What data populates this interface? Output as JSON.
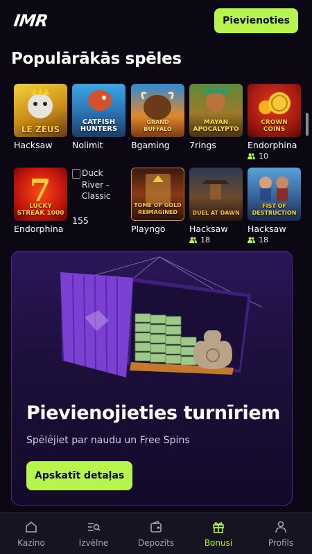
{
  "header": {
    "logo": "IMR",
    "join_label": "Pievienoties"
  },
  "popular": {
    "title": "Populārākās spēles",
    "games": [
      {
        "thumb_title": "LE ZEUS",
        "provider": "Hacksaw",
        "players": ""
      },
      {
        "thumb_title": "CATFISH HUNTERS",
        "provider": "Nolimit",
        "players": ""
      },
      {
        "thumb_title": "GRAND BUFFALO",
        "provider": "Bgaming",
        "players": ""
      },
      {
        "thumb_title": "MAYAN APOCALYPTO",
        "provider": "7rings",
        "players": ""
      },
      {
        "thumb_title": "CROWN COINS",
        "provider": "Endorphina",
        "players": "10"
      },
      {
        "thumb_title": "LUCKY STREAK 1000",
        "provider": "Endorphina",
        "players": ""
      },
      {
        "thumb_title": "Duck River - Classic",
        "provider": "",
        "players": "155"
      },
      {
        "thumb_title": "TOME OF GOLD REIMAGINED",
        "provider": "Playngo",
        "players": ""
      },
      {
        "thumb_title": "DUEL AT DAWN",
        "provider": "Hacksaw",
        "players": "18"
      },
      {
        "thumb_title": "FIST OF DESTRUCTION",
        "provider": "Hacksaw",
        "players": "18"
      }
    ]
  },
  "promo": {
    "title": "Pievienojieties turnīriem",
    "subtitle": "Spēlējiet par naudu un Free Spins",
    "button_label": "Apskatīt detaļas"
  },
  "nav": {
    "items": [
      {
        "label": "Kazino",
        "icon": "home-icon"
      },
      {
        "label": "Izvēlne",
        "icon": "menu-search-icon"
      },
      {
        "label": "Depozīts",
        "icon": "wallet-icon"
      },
      {
        "label": "Bonusi",
        "icon": "gift-icon",
        "active": true
      },
      {
        "label": "Profils",
        "icon": "user-icon"
      }
    ]
  },
  "colors": {
    "accent": "#b5f54e",
    "background": "#0b0814",
    "promo_purple": "#2a1658"
  }
}
